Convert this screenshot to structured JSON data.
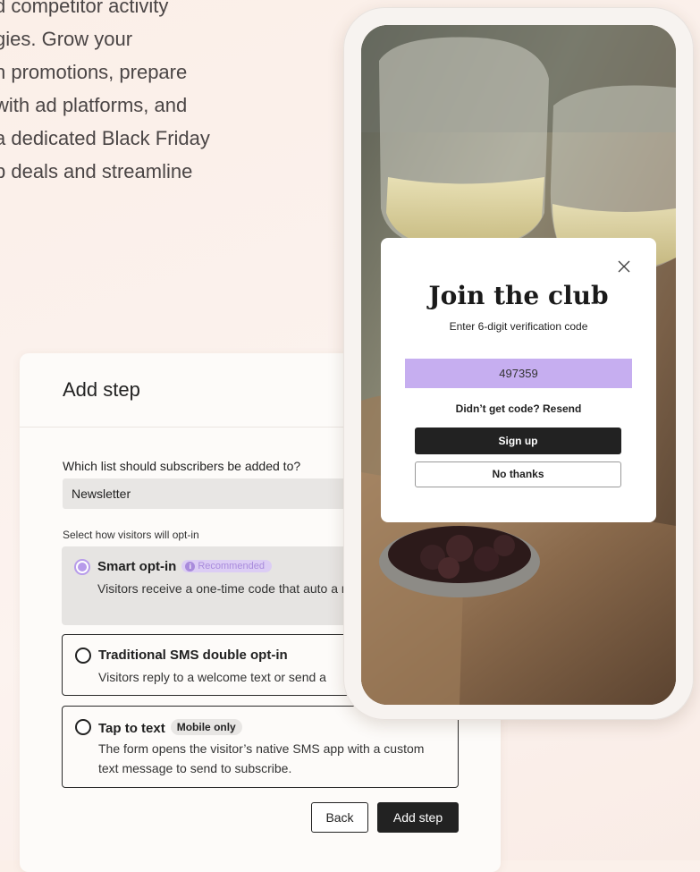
{
  "background_text": {
    "lines": [
      "d competitor activity",
      "gies. Grow your",
      "n promotions, prepare",
      "with ad platforms, and",
      "a dedicated Black Friday",
      "p deals and streamline"
    ]
  },
  "add_step": {
    "title": "Add step",
    "list_question": "Which list should subscribers be added to?",
    "list_value": "Newsletter",
    "optin_label": "Select how visitors will opt-in",
    "options": [
      {
        "title": "Smart opt-in",
        "badge": "Recommended",
        "description": "Visitors receive a one-time code that auto a mobile device.",
        "selected": true
      },
      {
        "title": "Traditional SMS double opt-in",
        "description": "Visitors reply to a welcome text or send a",
        "selected": false
      },
      {
        "title": "Tap to text",
        "badge": "Mobile only",
        "description": "The form opens the visitor’s native SMS app with a custom text message to send to subscribe.",
        "selected": false
      }
    ],
    "back_label": "Back",
    "add_label": "Add step"
  },
  "phone_modal": {
    "title": "Join the club",
    "subtitle": "Enter 6-digit verification code",
    "code": "497359",
    "resend": "Didn’t get code? Resend",
    "signup_label": "Sign up",
    "no_thanks_label": "No thanks"
  },
  "colors": {
    "accent_purple": "#c6aef0",
    "dark_button": "#222222",
    "page_background": "#fbf1ec"
  }
}
